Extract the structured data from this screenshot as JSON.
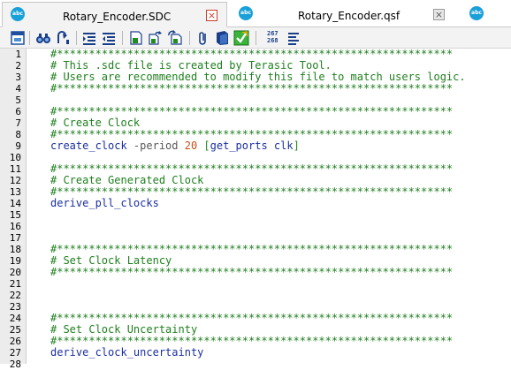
{
  "tabs": [
    {
      "title": "Rotary_Encoder.SDC",
      "icon": "abc-file-icon",
      "icon_text": "abc",
      "active": true,
      "close_glyph": "×"
    },
    {
      "title": "Rotary_Encoder.qsf",
      "icon": "abc-file-icon",
      "icon_text": "abc",
      "active": false,
      "close_glyph": "×"
    },
    {
      "title": "",
      "icon": "abc-file-icon",
      "icon_text": "abc",
      "active": false
    }
  ],
  "toolbar": {
    "buttons": [
      "new-window-icon",
      "find-icon",
      "find-next-icon",
      "indent-icon",
      "unindent-icon",
      "bookmark-icon",
      "insert-template-icon",
      "replace-icon",
      "paperclip-icon",
      "book-icon",
      "check-icon",
      "line-numbers-icon",
      "align-lines-icon"
    ],
    "line_counter_top": "267",
    "line_counter_bottom": "268"
  },
  "colors": {
    "comment": "#1e7f1e",
    "keyword": "#1a2fa0",
    "number": "#c8501a",
    "active_tab_close": "#cc3c2c",
    "tab_icon": "#1aa0d8"
  },
  "editor": {
    "line_numbers": [
      "1",
      "2",
      "3",
      "4",
      "5",
      "6",
      "7",
      "8",
      "9",
      "10",
      "11",
      "12",
      "13",
      "14",
      "15",
      "16",
      "17",
      "18",
      "19",
      "20",
      "21",
      "22",
      "23",
      "24",
      "25",
      "26",
      "27",
      "28"
    ],
    "lines": [
      {
        "type": "comment",
        "text": "#**************************************************************"
      },
      {
        "type": "comment",
        "text": "# This .sdc file is created by Terasic Tool."
      },
      {
        "type": "comment",
        "text": "# Users are recommended to modify this file to match users logic."
      },
      {
        "type": "comment",
        "text": "#**************************************************************"
      },
      {
        "type": "blank",
        "text": ""
      },
      {
        "type": "comment",
        "text": "#**************************************************************"
      },
      {
        "type": "comment",
        "text": "# Create Clock"
      },
      {
        "type": "comment",
        "text": "#**************************************************************"
      },
      {
        "type": "create_clock",
        "cmd": "create_clock",
        "arg": " -period",
        "num": " 20",
        "open": " [",
        "sub": "get_ports clk",
        "close": "]"
      },
      {
        "type": "blank",
        "text": ""
      },
      {
        "type": "comment",
        "text": "#**************************************************************"
      },
      {
        "type": "comment",
        "text": "# Create Generated Clock"
      },
      {
        "type": "comment",
        "text": "#**************************************************************"
      },
      {
        "type": "keyword",
        "text": "derive_pll_clocks"
      },
      {
        "type": "blank",
        "text": ""
      },
      {
        "type": "blank",
        "text": ""
      },
      {
        "type": "blank",
        "text": ""
      },
      {
        "type": "comment",
        "text": "#**************************************************************"
      },
      {
        "type": "comment",
        "text": "# Set Clock Latency"
      },
      {
        "type": "comment",
        "text": "#**************************************************************"
      },
      {
        "type": "blank",
        "text": ""
      },
      {
        "type": "blank",
        "text": ""
      },
      {
        "type": "blank",
        "text": ""
      },
      {
        "type": "comment",
        "text": "#**************************************************************"
      },
      {
        "type": "comment",
        "text": "# Set Clock Uncertainty"
      },
      {
        "type": "comment",
        "text": "#**************************************************************"
      },
      {
        "type": "keyword",
        "text": "derive_clock_uncertainty"
      },
      {
        "type": "blank",
        "text": ""
      }
    ]
  }
}
